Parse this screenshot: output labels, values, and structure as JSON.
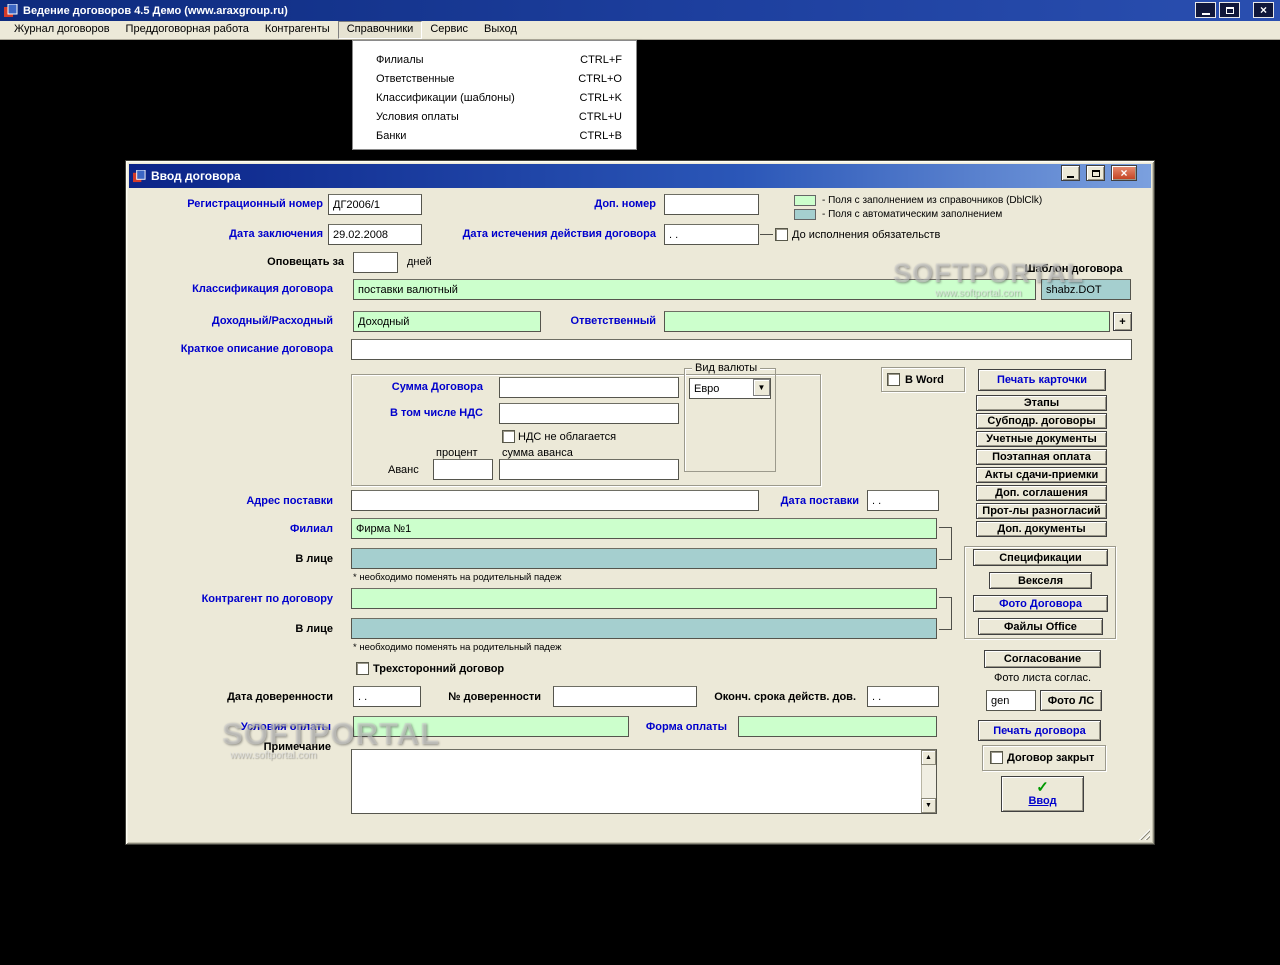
{
  "window": {
    "title": "Ведение договоров 4.5 Демо (www.araxgroup.ru)"
  },
  "menubar": {
    "items": [
      "Журнал договоров",
      "Преддоговорная работа",
      "Контрагенты",
      "Справочники",
      "Сервис",
      "Выход"
    ]
  },
  "dropdown_menu": {
    "items": [
      {
        "label": "Филиалы",
        "shortcut": "CTRL+F"
      },
      {
        "label": "Ответственные",
        "shortcut": "CTRL+O"
      },
      {
        "label": "Классификации (шаблоны)",
        "shortcut": "CTRL+K"
      },
      {
        "label": "Условия оплаты",
        "shortcut": "CTRL+U"
      },
      {
        "label": "Банки",
        "shortcut": "CTRL+B"
      }
    ]
  },
  "watermark": {
    "text": "SOFTPORTAL",
    "url": "www.softportal.com"
  },
  "colors": {
    "reference_field": "#ccffcc",
    "auto_field": "#a5cfcf",
    "label_blue": "#0000cc",
    "dialog_background": "#ece9d8",
    "close_button": "#c2401f"
  },
  "dialog": {
    "title": "Ввод договора",
    "legend_ref": "- Поля с заполнением из справочников (DblClk)",
    "legend_auto": "- Поля с автоматическим заполнением",
    "reg_number": {
      "label": "Регистрационный номер",
      "value": "ДГ2006/1"
    },
    "extra_number": {
      "label": "Доп. номер",
      "value": ""
    },
    "conclusion_date": {
      "label": "Дата заключения",
      "value": "29.02.2008"
    },
    "expiry_date": {
      "label": "Дата истечения действия договора",
      "value": ".  ."
    },
    "until_obligations_label": "До исполнения обязательств",
    "notify_label": "Оповещать за",
    "notify_value": "",
    "notify_suffix": "дней",
    "template_caption": "Шаблон договора",
    "template_file": "shabz.DOT",
    "classification": {
      "label": "Классификация договора",
      "value": "поставки валютный"
    },
    "income_type": {
      "label": "Доходный/Расходный",
      "value": "Доходный"
    },
    "responsible": {
      "label": "Ответственный",
      "value": "",
      "add": "+"
    },
    "short_description": {
      "label": "Краткое описание договора",
      "value": ""
    },
    "amount": {
      "sum_label": "Сумма Договора",
      "sum_value": "",
      "currency_label": "Вид валюты",
      "currency_value": "Евро",
      "vat_label": "В том числе НДС",
      "vat_value": "",
      "vat_exempt_label": "НДС не облагается",
      "percent_caption": "процент",
      "advance_caption": "сумма аванса",
      "advance_label": "Аванс",
      "percent_value": "",
      "advance_value": ""
    },
    "word_checkbox_label": "В Word",
    "print_card_button": "Печать карточки",
    "side_buttons": [
      "Этапы",
      "Субподр. договоры",
      "Учетные документы",
      "Поэтапная оплата",
      "Акты сдачи-приемки",
      "Доп. соглашения",
      "Прот-лы разногласий",
      "Доп. документы"
    ],
    "delivery_address": {
      "label": "Адрес поставки",
      "value": ""
    },
    "delivery_date": {
      "label": "Дата поставки",
      "value": ".  ."
    },
    "branch": {
      "label": "Филиал",
      "value": "Фирма №1"
    },
    "branch_person": {
      "label": "В лице",
      "value": ""
    },
    "genitive_note": "* необходимо поменять на родительный падеж",
    "docs_buttons": [
      "Спецификации",
      "Векселя",
      "Фото Договора",
      "Файлы Office"
    ],
    "counterparty": {
      "label": "Контрагент по договору",
      "value": ""
    },
    "counterparty_person": {
      "label": "В лице",
      "value": ""
    },
    "tripartite_label": "Трехсторонний договор",
    "approval_button": "Согласование",
    "approval_photo_caption": "Фото листа соглас.",
    "approval_photo_value": "gen",
    "photo_ls_button": "Фото ЛС",
    "poa_date": {
      "label": "Дата доверенности",
      "value": ".  ."
    },
    "poa_number": {
      "label": "№ доверенности",
      "value": ""
    },
    "poa_expiry": {
      "label": "Оконч. срока действ. дов.",
      "value": ".  ."
    },
    "payment_terms": {
      "label": "Условия оплаты",
      "value": ""
    },
    "payment_form": {
      "label": "Форма оплаты",
      "value": ""
    },
    "note_label": "Примечание",
    "note_value": "",
    "print_contract_button": "Печать договора",
    "contract_closed_label": "Договор закрыт",
    "submit_button": "Ввод"
  }
}
